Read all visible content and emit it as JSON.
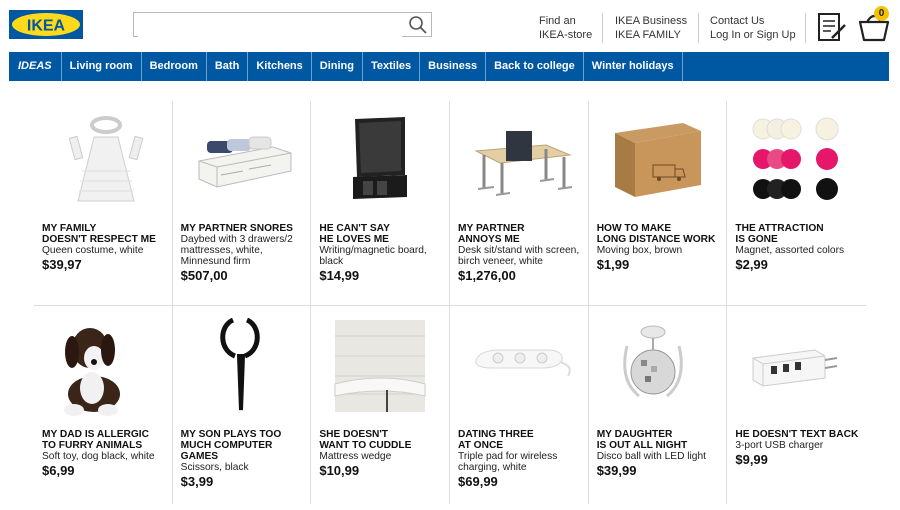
{
  "brand": {
    "logo_text": "IKEA"
  },
  "search": {
    "value": "",
    "placeholder": ""
  },
  "header_links": [
    {
      "line1": "Find an",
      "line2": "IKEA-store"
    },
    {
      "line1": "IKEA Business",
      "line2": "IKEA FAMILY"
    },
    {
      "line1": "Contact Us",
      "line2": "Log In or Sign Up"
    }
  ],
  "cart": {
    "count": "0"
  },
  "nav": [
    "IDEAS",
    "Living room",
    "Bedroom",
    "Bath",
    "Kitchens",
    "Dining",
    "Textiles",
    "Business",
    "Back to college",
    "Winter holidays"
  ],
  "products": [
    {
      "title1": "MY FAMILY",
      "title2": "DOESN'T RESPECT ME",
      "desc1": "Queen costume, white",
      "desc2": "",
      "desc3": "",
      "price": "$39,97"
    },
    {
      "title1": "MY PARTNER SNORES",
      "title2": "",
      "desc1": "Daybed with 3 drawers/2",
      "desc2": "mattresses, white,",
      "desc3": "Minnesund firm",
      "price": "$507,00"
    },
    {
      "title1": "HE CAN'T SAY",
      "title2": "HE LOVES ME",
      "desc1": "Writing/magnetic board,",
      "desc2": "black",
      "desc3": "",
      "price": "$14,99"
    },
    {
      "title1": "MY PARTNER",
      "title2": "ANNOYS ME",
      "desc1": "Desk sit/stand with screen,",
      "desc2": "birch veneer, white",
      "desc3": "",
      "price": "$1,276,00"
    },
    {
      "title1": "HOW TO MAKE",
      "title2": "LONG DISTANCE WORK",
      "desc1": "Moving box, brown",
      "desc2": "",
      "desc3": "",
      "price": "$1,99"
    },
    {
      "title1": "THE ATTRACTION",
      "title2": "IS GONE",
      "desc1": "Magnet, assorted colors",
      "desc2": "",
      "desc3": "",
      "price": "$2,99"
    },
    {
      "title1": "MY DAD IS ALLERGIC",
      "title2": "TO FURRY ANIMALS",
      "desc1": "Soft toy, dog black, white",
      "desc2": "",
      "desc3": "",
      "price": "$6,99"
    },
    {
      "title1": "MY SON PLAYS TOO",
      "title2": "MUCH COMPUTER",
      "title3": "GAMES",
      "desc1": "Scissors, black",
      "desc2": "",
      "desc3": "",
      "price": "$3,99"
    },
    {
      "title1": "SHE DOESN'T",
      "title2": "WANT TO CUDDLE",
      "desc1": "Mattress wedge",
      "desc2": "",
      "desc3": "",
      "price": "$10,99"
    },
    {
      "title1": "DATING THREE",
      "title2": "AT ONCE",
      "desc1": "Triple pad for wireless",
      "desc2": "charging, white",
      "desc3": "",
      "price": "$69,99"
    },
    {
      "title1": "MY DAUGHTER",
      "title2": "IS OUT ALL NIGHT",
      "desc1": "Disco ball with LED light",
      "desc2": "",
      "desc3": "",
      "price": "$39,99"
    },
    {
      "title1": "HE DOESN'T TEXT BACK",
      "title2": "",
      "desc1": "3-port USB charger",
      "desc2": "",
      "desc3": "",
      "price": "$9,99"
    }
  ],
  "colors": {
    "brand_blue": "#0058a3",
    "brand_yellow": "#ffda1a",
    "badge": "#f5c400"
  },
  "icons": {
    "search": "search-icon",
    "list": "shopping-list-icon",
    "cart": "basket-icon"
  }
}
